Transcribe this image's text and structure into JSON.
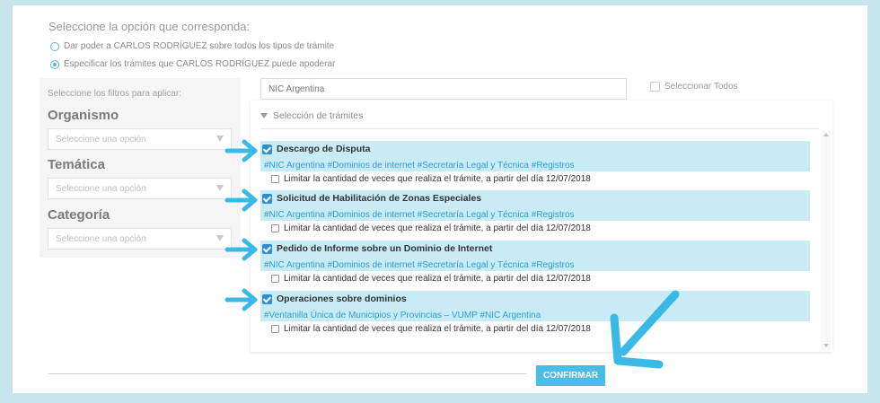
{
  "heading": "Seleccione la opción que corresponda:",
  "options": [
    {
      "label": "Dar poder a CARLOS RODRÍGUEZ sobre todos los tipos de trámite",
      "selected": false
    },
    {
      "label": "Especificar los trámites que CARLOS RODRÍGUEZ puede apoderar",
      "selected": true
    }
  ],
  "filters": {
    "title": "Seleccione los filtros para aplicar:",
    "organismo": {
      "label": "Organismo",
      "placeholder": "Seleccione una opción"
    },
    "tematica": {
      "label": "Temática",
      "placeholder": "Seleccione una opción"
    },
    "categoria": {
      "label": "Categoría",
      "placeholder": "Seleccione una opción"
    }
  },
  "search": {
    "value": "NIC Argentina"
  },
  "select_all": "Seleccionar Todos",
  "section_title": "Selección de trámites",
  "items": [
    {
      "title": "Descargo de Disputa",
      "tags": "#NIC Argentina #Dominios de internet #Secretaría Legal y Técnica #Registros",
      "limit": "Limitar la cantidad de veces que realiza el trámite, a partir del día 12/07/2018",
      "checked": true
    },
    {
      "title": "Solicitud de Habilitación de Zonas Especiales",
      "tags": "#NIC Argentina #Dominios de internet #Secretaría Legal y Técnica #Registros",
      "limit": "Limitar la cantidad de veces que realiza el trámite, a partir del día 12/07/2018",
      "checked": true
    },
    {
      "title": "Pedido de Informe sobre un Dominio de Internet",
      "tags": "#NIC Argentina #Dominios de internet #Secretaría Legal y Técnica #Registros",
      "limit": "Limitar la cantidad de veces que realiza el trámite, a partir del día 12/07/2018",
      "checked": true
    },
    {
      "title": "Operaciones sobre dominios",
      "tags": "#Ventanilla Única de Municipios y Provincias – VUMP #NIC Argentina",
      "limit": "Limitar la cantidad de veces que realiza el trámite, a partir del día 12/07/2018",
      "checked": true
    }
  ],
  "confirm_label": "CONFIRMAR",
  "colors": {
    "accent": "#49bde8",
    "highlight": "#c8ebf6",
    "arrow": "#3bb9e6",
    "background": "#c6e5ec"
  },
  "icons": {
    "pointer": "arrow-right-icon",
    "callout": "arrow-down-left-icon"
  }
}
